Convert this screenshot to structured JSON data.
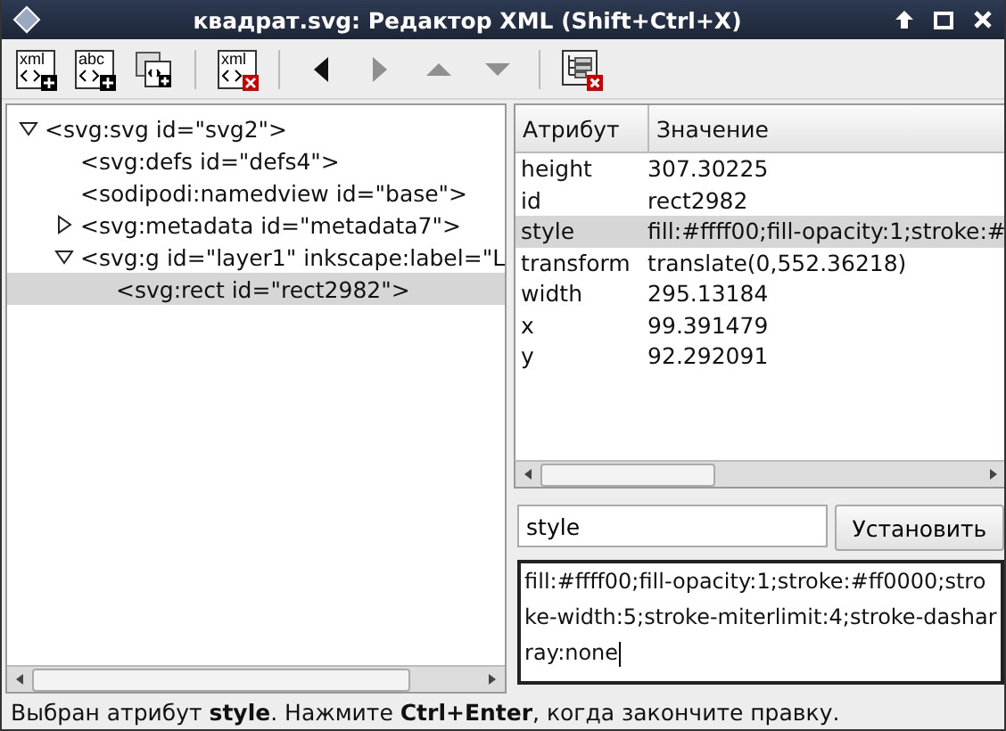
{
  "window": {
    "title": "квадрат.svg: Редактор XML (Shift+Ctrl+X)"
  },
  "toolbar": [
    {
      "kind": "new-element",
      "label": "xml"
    },
    {
      "kind": "new-text",
      "label": "abc"
    },
    {
      "kind": "duplicate"
    },
    {
      "kind": "separator"
    },
    {
      "kind": "delete",
      "label": "xml"
    },
    {
      "kind": "separator"
    },
    {
      "kind": "unindent",
      "disabled": false
    },
    {
      "kind": "indent",
      "disabled": true
    },
    {
      "kind": "raise",
      "disabled": true
    },
    {
      "kind": "lower",
      "disabled": true
    },
    {
      "kind": "separator"
    },
    {
      "kind": "delete-attribute"
    }
  ],
  "tree": [
    {
      "label": "<svg:svg id=\"svg2\">",
      "expanded": true,
      "selected": false,
      "children": [
        {
          "label": "<svg:defs id=\"defs4\">",
          "selected": false
        },
        {
          "label": "<sodipodi:namedview id=\"base\">",
          "selected": false
        },
        {
          "label": "<svg:metadata id=\"metadata7\">",
          "expanded": false,
          "selected": false
        },
        {
          "label": "<svg:g id=\"layer1\" inkscape:label=\"L",
          "expanded": true,
          "selected": false,
          "children": [
            {
              "label": "<svg:rect id=\"rect2982\">",
              "selected": true
            }
          ]
        }
      ]
    }
  ],
  "attributes": {
    "columns": [
      "Атрибут",
      "Значение"
    ],
    "rows": [
      {
        "name": "height",
        "value": "307.30225",
        "selected": false
      },
      {
        "name": "id",
        "value": "rect2982",
        "selected": false
      },
      {
        "name": "style",
        "value": "fill:#ffff00;fill-opacity:1;stroke:#",
        "selected": true
      },
      {
        "name": "transform",
        "value": "translate(0,552.36218)",
        "selected": false
      },
      {
        "name": "width",
        "value": "295.13184",
        "selected": false
      },
      {
        "name": "x",
        "value": "99.391479",
        "selected": false
      },
      {
        "name": "y",
        "value": "92.292091",
        "selected": false
      }
    ]
  },
  "attribute_name": {
    "value": "style"
  },
  "set_button": "Установить",
  "attribute_value": {
    "value": "fill:#ffff00;fill-opacity:1;stroke:#ff0000;stroke-width:5;stroke-miterlimit:4;stroke-dasharray:none"
  },
  "status_bar": "Выбран атрибут **style**. Нажмите **Ctrl+Enter**, когда закончите правку."
}
